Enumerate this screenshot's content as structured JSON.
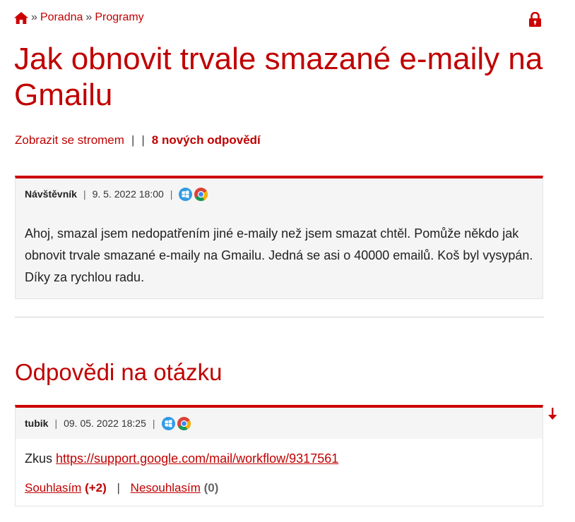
{
  "breadcrumb": {
    "home_icon": "home-icon",
    "separator": "»",
    "items": [
      "Poradna",
      "Programy"
    ]
  },
  "lock_icon": "lock-icon",
  "title": "Jak obnovit trvale smazané e-maily na Gmailu",
  "tree_row": {
    "show_tree_label": "Zobrazit se stromem",
    "separator": "|",
    "new_answers_label": "8 nových odpovědí"
  },
  "question": {
    "author": "Návštěvník",
    "date": "9. 5. 2022 18:00",
    "os_icon": "windows-icon",
    "browser_icon": "chrome-icon",
    "text": "Ahoj, smazal jsem nedopatřením jiné e-maily než jsem smazat chtěl. Pomůže někdo jak obnovit trvale smazané e-maily na Gmailu. Jedná se asi o 40000 emailů. Koš byl vysypán. Díky za rychlou radu."
  },
  "answers_heading": "Odpovědi na otázku",
  "answers": [
    {
      "author": "tubik",
      "date": "09. 05. 2022 18:25",
      "os_icon": "windows-icon",
      "browser_icon": "chrome-icon",
      "text_prefix": "Zkus ",
      "link": "https://support.google.com/mail/workflow/9317561",
      "agree_label": "Souhlasím",
      "agree_count": "(+2)",
      "disagree_label": "Nesouhlasím",
      "disagree_count": "(0)"
    }
  ],
  "colors": {
    "accent": "#c00000",
    "post_background": "#f5f5f5"
  }
}
